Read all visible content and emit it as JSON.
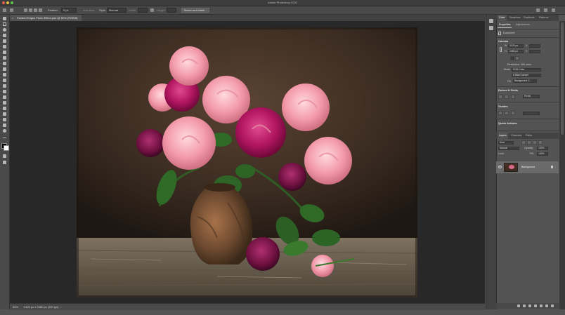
{
  "window": {
    "title": "Adobe Photoshop 2020"
  },
  "options_bar": {
    "feather_label": "Feather:",
    "feather_value": "0 px",
    "anti_alias_label": "Anti-alias",
    "style_label": "Style:",
    "style_value": "Normal",
    "width_label": "Width:",
    "height_label": "Height:",
    "select_mask_button": "Select and Mask..."
  },
  "document": {
    "tab_label": "Painted Edges Photo Effect.psd @ 50% (RGB/8)",
    "close_glyph": "×"
  },
  "status_bar": {
    "zoom": "50%",
    "doc_info": "3120 px x 2480 px (300 ppi)",
    "arrow": "›"
  },
  "panels": {
    "top_tabs": [
      "Color",
      "Swatches",
      "Gradients",
      "Patterns"
    ],
    "prop_tabs": [
      "Properties",
      "Adjustments"
    ],
    "document_label": "Document",
    "canvas": {
      "title": "Canvas",
      "w_label": "W",
      "w_value": "3120 px",
      "h_label": "H",
      "h_value": "2480 px",
      "x_label": "X",
      "y_label": "Y",
      "resolution": "Resolution: 300 pixel...",
      "mode_label": "Mode",
      "mode_value": "RGB Color",
      "depth_value": "8 Bits/Channel",
      "fill_label": "Fill",
      "fill_value": "Background C..."
    },
    "rulers": {
      "title": "Rulers & Grids",
      "units": "Pixels"
    },
    "guides": {
      "title": "Guides"
    },
    "quick": {
      "title": "Quick Actions"
    },
    "layers_tabs": [
      "Layers",
      "Channels",
      "Paths"
    ],
    "layers": {
      "kind_label": "Kind",
      "blend_mode": "Normal",
      "opacity_label": "Opacity:",
      "opacity_value": "100%",
      "lock_label": "Lock:",
      "fill_label": "Fill:",
      "fill_value": "100%",
      "background_layer": "Background"
    }
  },
  "icons": [
    "apple-icon",
    "home-icon",
    "marquee-icon",
    "lasso-icon",
    "crop-icon",
    "brush-icon",
    "eraser-icon",
    "type-icon",
    "hand-icon",
    "zoom-icon",
    "lock-icon",
    "eye-icon",
    "search-icon",
    "workspace-icon"
  ],
  "colors": {
    "ui_dark": "#282828",
    "panel": "#535353",
    "foreground": "#000000",
    "background": "#ffffff"
  }
}
